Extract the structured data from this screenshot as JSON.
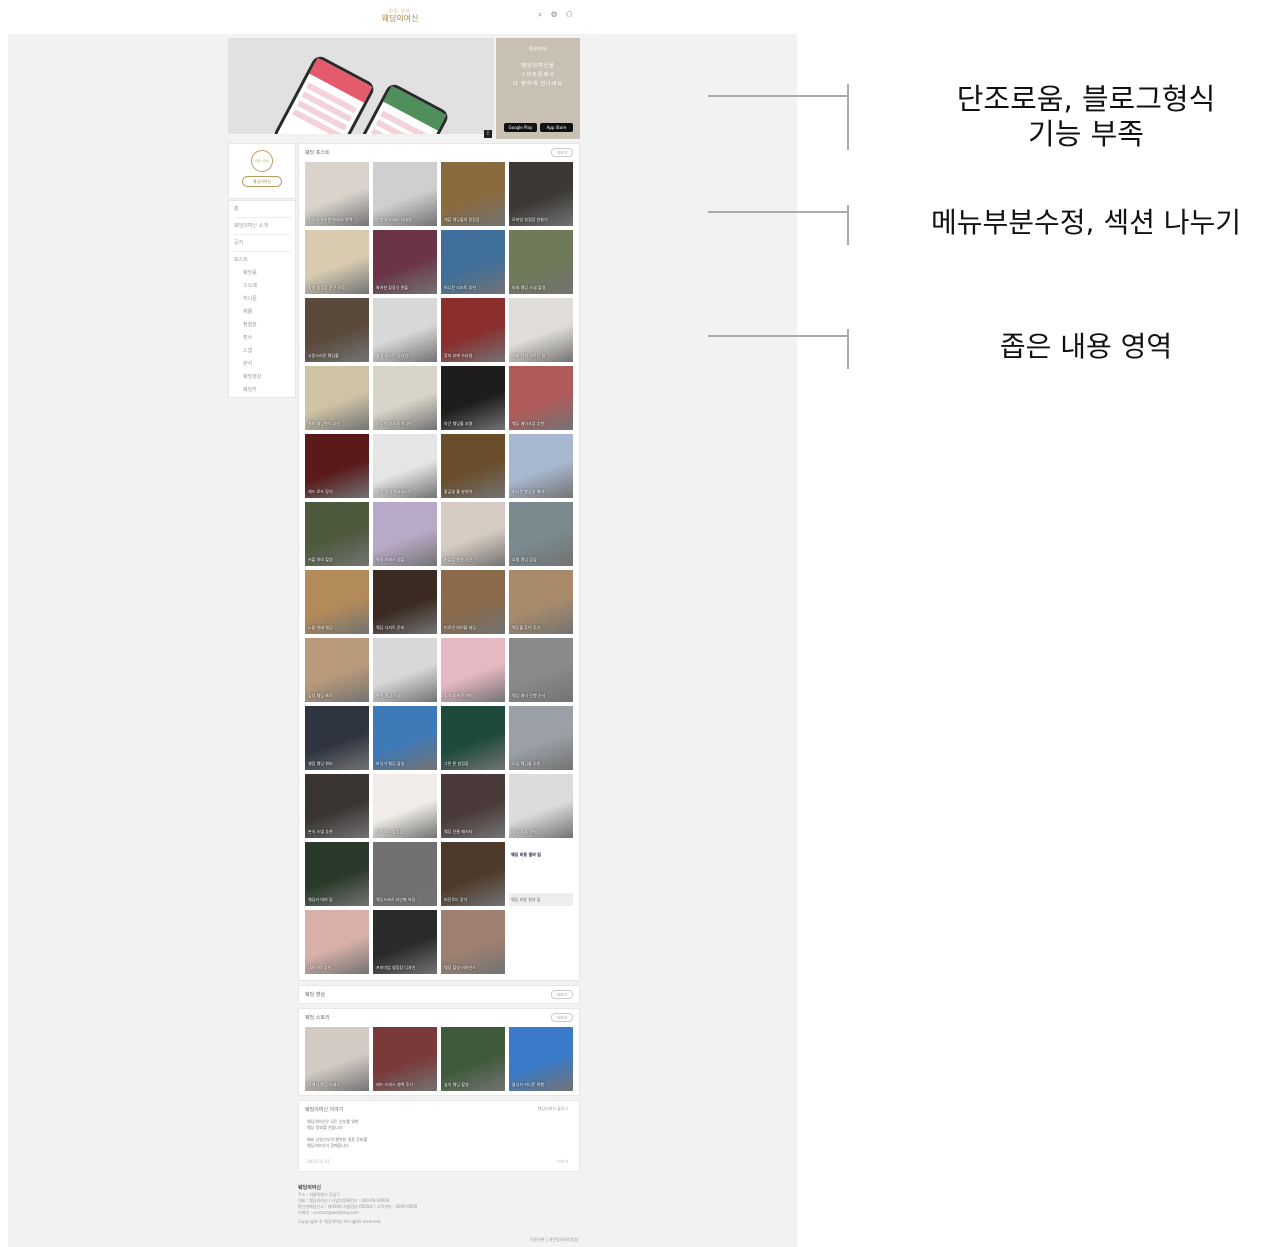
{
  "site": {
    "logo_mark": "◇◇ ◇◇",
    "logo_text": "웨딩의여신",
    "icons": [
      "search-icon",
      "settings-icon",
      "user-icon"
    ]
  },
  "banner": {
    "side_logo": "웨딩의여신",
    "side_text_lines": [
      "웨딩의여신을",
      "스마트폰에서",
      "더 편하게 만나세요"
    ],
    "store_google": "Google Play",
    "store_apple": "App Store",
    "info_badge": "i"
  },
  "profile": {
    "circle_text": "◇◇ ◇◇",
    "button_label": "웨딩의여신"
  },
  "sidebar": {
    "items": [
      "홈",
      "웨딩의여신 소개",
      "공지",
      "포스트"
    ],
    "sub_items": [
      "웨딩홀",
      "스드메",
      "허니문",
      "예물",
      "청첩장",
      "혼수",
      "스냅",
      "본식",
      "웨딩영상",
      "웨딩카"
    ]
  },
  "main_section": {
    "title": "웨딩 포스트",
    "more_label": "더보기",
    "tiles": [
      {
        "caption": "신부의 우아한 드레스 셀렉",
        "color": "#d9d3cc"
      },
      {
        "caption": "순백의 드레스 디테일",
        "color": "#cfcfcf"
      },
      {
        "caption": "채플 웨딩홀의 웅장함",
        "color": "#8a6b3f"
      },
      {
        "caption": "모바일 청첩장 만들기",
        "color": "#3b3835"
      },
      {
        "caption": "종이 청첩장 문구 모음",
        "color": "#d8cbb0"
      },
      {
        "caption": "화려한 꽃장식 연출",
        "color": "#6b3546"
      },
      {
        "caption": "허니문 리조트 추천",
        "color": "#3f6f9a"
      },
      {
        "caption": "야외 웨딩 스냅 촬영",
        "color": "#6f7a58"
      },
      {
        "caption": "고풍스러운 웨딩홀",
        "color": "#5a4a3c"
      },
      {
        "caption": "하객 리스트 정리법",
        "color": "#d8d8d8"
      },
      {
        "caption": "장미 부케 스타일",
        "color": "#8a2e2e"
      },
      {
        "caption": "예물 반지 고르는 팁",
        "color": "#e0ddd8"
      },
      {
        "caption": "골드 웨딩밴드 추천",
        "color": "#cfc3a6"
      },
      {
        "caption": "이니셜 데코 아이디어",
        "color": "#d9d4c8"
      },
      {
        "caption": "야간 웨딩홀 조명",
        "color": "#1f1d1c"
      },
      {
        "caption": "웨딩 메이크업 추천",
        "color": "#b15a5a"
      },
      {
        "caption": "레드 로즈 장식",
        "color": "#5a1a1a"
      },
      {
        "caption": "결혼 준비 체크리스트",
        "color": "#e5e5e5"
      },
      {
        "caption": "황금빛 홀 분위기",
        "color": "#6a4e2c"
      },
      {
        "caption": "허니문 항공권 예약",
        "color": "#a8b8d0"
      },
      {
        "caption": "커플 야외 촬영",
        "color": "#4e5a3e"
      },
      {
        "caption": "컬러 드레스 샘플",
        "color": "#b9a9c8"
      },
      {
        "caption": "커플링 착용 사진",
        "color": "#d6cbc2"
      },
      {
        "caption": "호텔 웨딩 상담",
        "color": "#7a8a8f"
      },
      {
        "caption": "노을 아래 웨딩",
        "color": "#b38a5a"
      },
      {
        "caption": "웨딩 디저트 준비",
        "color": "#3a2a22"
      },
      {
        "caption": "피로연 테이블 세팅",
        "color": "#8a6a4a"
      },
      {
        "caption": "웨딩홀 투어 후기",
        "color": "#a88a6a"
      },
      {
        "caption": "감성 웨딩 포토",
        "color": "#b99a7a"
      },
      {
        "caption": "흑백 웨딩 스냅",
        "color": "#d8d8d8"
      },
      {
        "caption": "핑크 부케 트렌드",
        "color": "#e6b8c2"
      },
      {
        "caption": "웨딩 예식 진행 순서",
        "color": "#8a8a8a"
      },
      {
        "caption": "셀럽 웨딩 화보",
        "color": "#2e3440"
      },
      {
        "caption": "바닷가 웨딩 촬영",
        "color": "#3f7ab8"
      },
      {
        "caption": "그린 톤 청첩장",
        "color": "#1e4a3e"
      },
      {
        "caption": "도심 웨딩홀 추천",
        "color": "#9aa0a6"
      },
      {
        "caption": "본식 스냅 추천",
        "color": "#3a3533"
      },
      {
        "caption": "일러스트 청첩장",
        "color": "#f0ede8"
      },
      {
        "caption": "웨딩 선물 패키지",
        "color": "#4a3a3a"
      },
      {
        "caption": "웨딩 소품 준비",
        "color": "#dcdcdc"
      },
      {
        "caption": "웨딩카 대여 팁",
        "color": "#2a3a2a"
      },
      {
        "caption": "웨딩드레스 라인별 특징",
        "color": "#707070"
      },
      {
        "caption": "버진로드 장식",
        "color": "#4e3a2a"
      },
      {
        "caption": "웨딩 비용 절약 팁",
        "color": "textonly",
        "title": "웨딩 비용 절약 팁"
      },
      {
        "caption": "네일아트 추천",
        "color": "#d8b0a8"
      },
      {
        "caption": "프리미엄 청첩장 디자인",
        "color": "#2a2a2a"
      },
      {
        "caption": "웨딩 촬영 비하인드",
        "color": "#a08070"
      }
    ]
  },
  "section2": {
    "title": "웨딩 영상",
    "more_label": "더보기"
  },
  "section3": {
    "title": "웨딩 스토리",
    "more_label": "더보기",
    "tiles": [
      {
        "caption": "클래식 웨딩 드레스",
        "color": "#d2cbc4"
      },
      {
        "caption": "레드 드레스 셀렉 후기",
        "color": "#7a3a3a"
      },
      {
        "caption": "숲속 웨딩 촬영",
        "color": "#3e5a3a"
      },
      {
        "caption": "몰디브 허니문 여행",
        "color": "#3a7ac8"
      }
    ]
  },
  "story_box": {
    "title": "웨딩의여신 이야기",
    "more_link": "웨딩의여신 블로그",
    "lines": [
      "웨딩의여신은 모든 신부를 위한",
      "웨딩 정보를 전합니다",
      "",
      "예비 신랑신부의 행복한 결혼 준비를",
      "웨딩의여신이 함께합니다"
    ],
    "date": "2020.01.01",
    "counter": "더보기"
  },
  "footer": {
    "heading": "웨딩의여신",
    "lines": [
      "주소 : 서울특별시 강남구",
      "대표 : 웨딩의여신  |  사업자등록번호 : 000-00-00000",
      "통신판매업신고 : 제0000-서울강남-0000호  |  고객센터 : 0000-0000",
      "이메일 : contact@wedding.com",
      "Copyright © 웨딩의여신 All rights reserved."
    ],
    "link_terms": "이용약관",
    "link_privacy": "개인정보처리방침"
  },
  "annotations": [
    {
      "text_line1": "단조로움, 블로그형식",
      "text_line2": "기능 부족"
    },
    {
      "text_line1": "메뉴부분수정, 섹션 나누기"
    },
    {
      "text_line1": "좁은 내용 영역"
    }
  ]
}
